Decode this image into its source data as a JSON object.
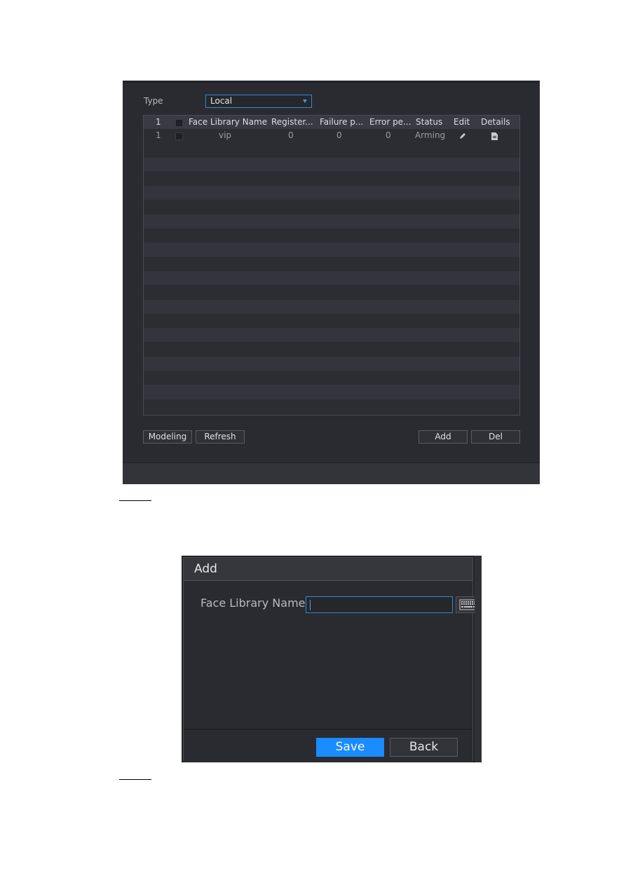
{
  "library_panel": {
    "type_label": "Type",
    "type_select": {
      "value": "Local"
    },
    "table": {
      "header": {
        "index": "1",
        "name": "Face Library Name",
        "registered": "Register...",
        "failure": "Failure p...",
        "error": "Error pe...",
        "status": "Status",
        "edit": "Edit",
        "details": "Details"
      },
      "rows": [
        {
          "index": "1",
          "name": "vip",
          "registered": "0",
          "failure": "0",
          "error": "0",
          "status": "Arming",
          "edit_icon": "pencil-icon",
          "details_icon": "document-icon"
        }
      ]
    },
    "buttons": {
      "modeling": "Modeling",
      "refresh": "Refresh",
      "add": "Add",
      "del": "Del"
    },
    "accent_color": "#2f8bd1"
  },
  "add_dialog": {
    "title": "Add",
    "field_label": "Face Library Name",
    "field_value": "",
    "keyboard_icon": "keyboard-icon",
    "buttons": {
      "save": "Save",
      "back": "Back"
    },
    "primary_color": "#1a8cff"
  }
}
